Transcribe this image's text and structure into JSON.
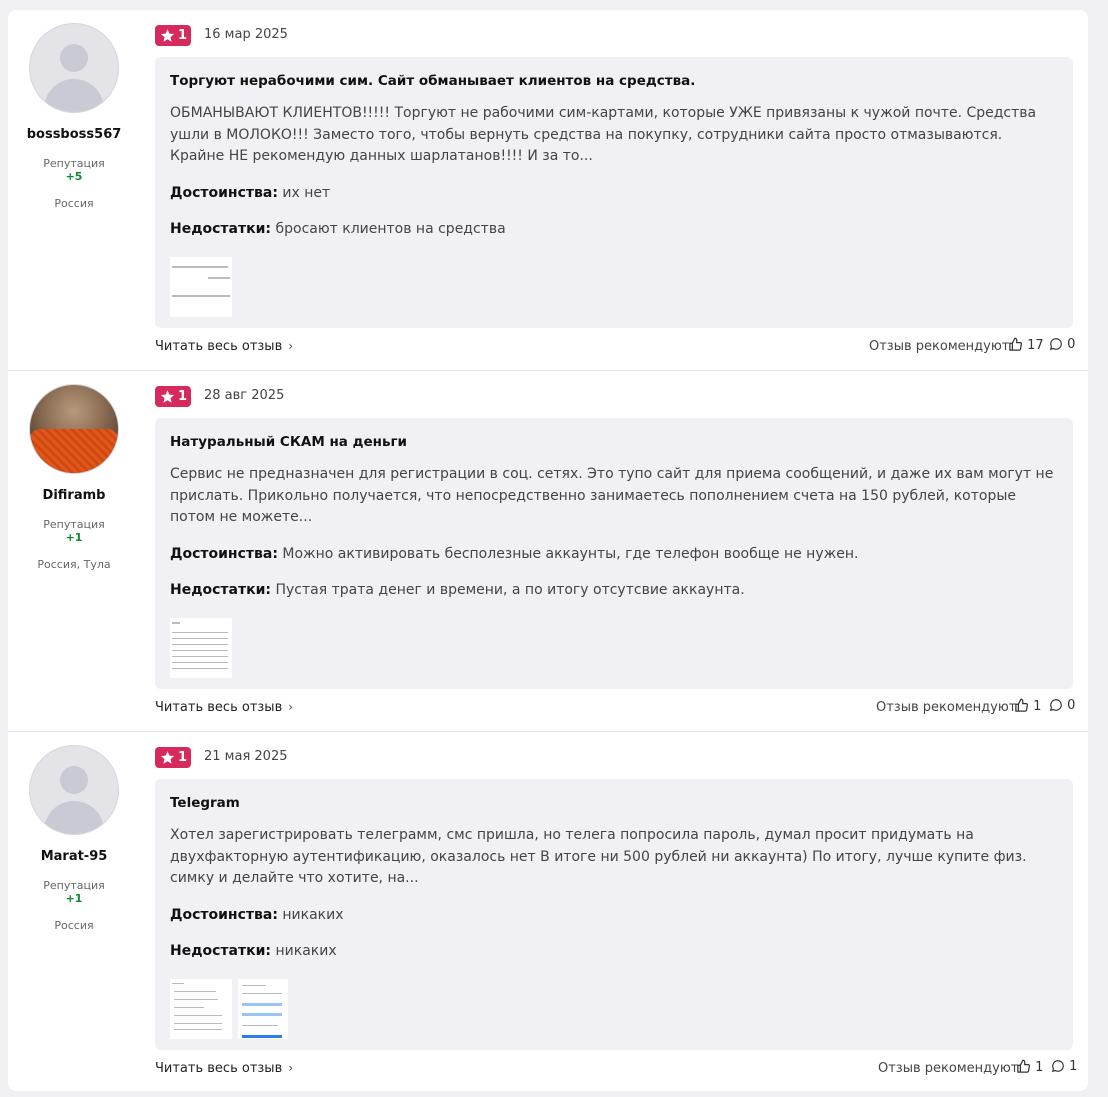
{
  "reviews": [
    {
      "user": {
        "name": "bossboss567",
        "rep_label": "Репутация",
        "rep_value": "+5",
        "location": "Россия"
      },
      "rating": "1",
      "date": "16 мар 2025",
      "title": "Торгуют нерабочими сим. Сайт обманывает клиентов на средства.",
      "text": "ОБМАНЫВАЮТ КЛИЕНТОВ!!!!! Торгуют не рабочими сим-картами, которые УЖЕ привязаны к чужой почте. Средства ушли в МОЛОКО!!! Заместо того, чтобы вернуть средства на покупку, сотрудники сайта просто отмазываются. Крайне НЕ рекомендую данных шарлатанов!!!! И за то...",
      "pros_label": "Достоинства:",
      "pros": "их нет",
      "cons_label": "Недостатки:",
      "cons": "бросают клиентов на средства",
      "read_more": "Читать весь отзыв",
      "recommend": "Отзыв рекомендуют",
      "likes": "17",
      "comments": "0"
    },
    {
      "user": {
        "name": "Difiramb",
        "rep_label": "Репутация",
        "rep_value": "+1",
        "location": "Россия, Тула"
      },
      "rating": "1",
      "date": "28 авг 2025",
      "title": "Натуральный СКАМ на деньги",
      "text": "Сервис не предназначен для регистрации в соц. сетях. Это тупо сайт для приема сообщений, и даже их вам могут не прислать. Прикольно получается, что непосредственно занимаетесь пополнением счета на 150 рублей, которые потом не можете...",
      "pros_label": "Достоинства:",
      "pros": "Можно активировать бесполезные аккаунты, где телефон вообще не нужен.",
      "cons_label": "Недостатки:",
      "cons": "Пустая трата денег и времени, а по итогу отсутсвие аккаунта.",
      "read_more": "Читать весь отзыв",
      "recommend": "Отзыв рекомендуют",
      "likes": "1",
      "comments": "0"
    },
    {
      "user": {
        "name": "Marat-95",
        "rep_label": "Репутация",
        "rep_value": "+1",
        "location": "Россия"
      },
      "rating": "1",
      "date": "21 мая 2025",
      "title": "Telegram",
      "text": "Хотел зарегистрировать телеграмм, смс пришла, но телега попросила пароль, думал просит придумать на двухфакторную аутентификацию, оказалось нет В итоге ни 500 рублей ни аккаунта) По итогу, лучше купите физ. симку и делайте что хотите, на...",
      "pros_label": "Достоинства:",
      "pros": "никаких",
      "cons_label": "Недостатки:",
      "cons": "никаких",
      "read_more": "Читать весь отзыв",
      "recommend": "Отзыв рекомендуют",
      "likes": "1",
      "comments": "1"
    }
  ]
}
